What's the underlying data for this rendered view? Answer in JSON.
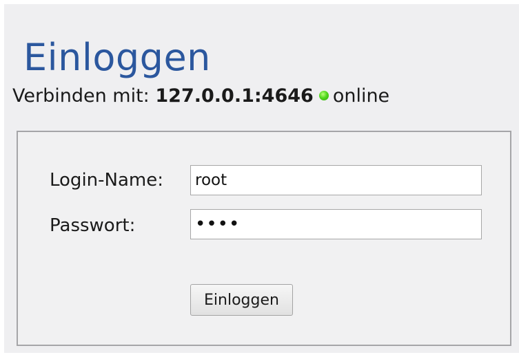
{
  "page": {
    "title": "Einloggen"
  },
  "connection": {
    "prefix": "Verbinden mit:",
    "host": "127.0.0.1:4646",
    "status_text": "online",
    "status_color": "#3cc516",
    "status_icon": "status-dot-icon"
  },
  "form": {
    "login_label": "Login-Name:",
    "login_value": "root",
    "password_label": "Passwort:",
    "password_value": "••••",
    "submit_label": "Einloggen"
  },
  "colors": {
    "title": "#2b579e",
    "panel_background": "#efeff1",
    "box_border": "#a5a5a8"
  }
}
